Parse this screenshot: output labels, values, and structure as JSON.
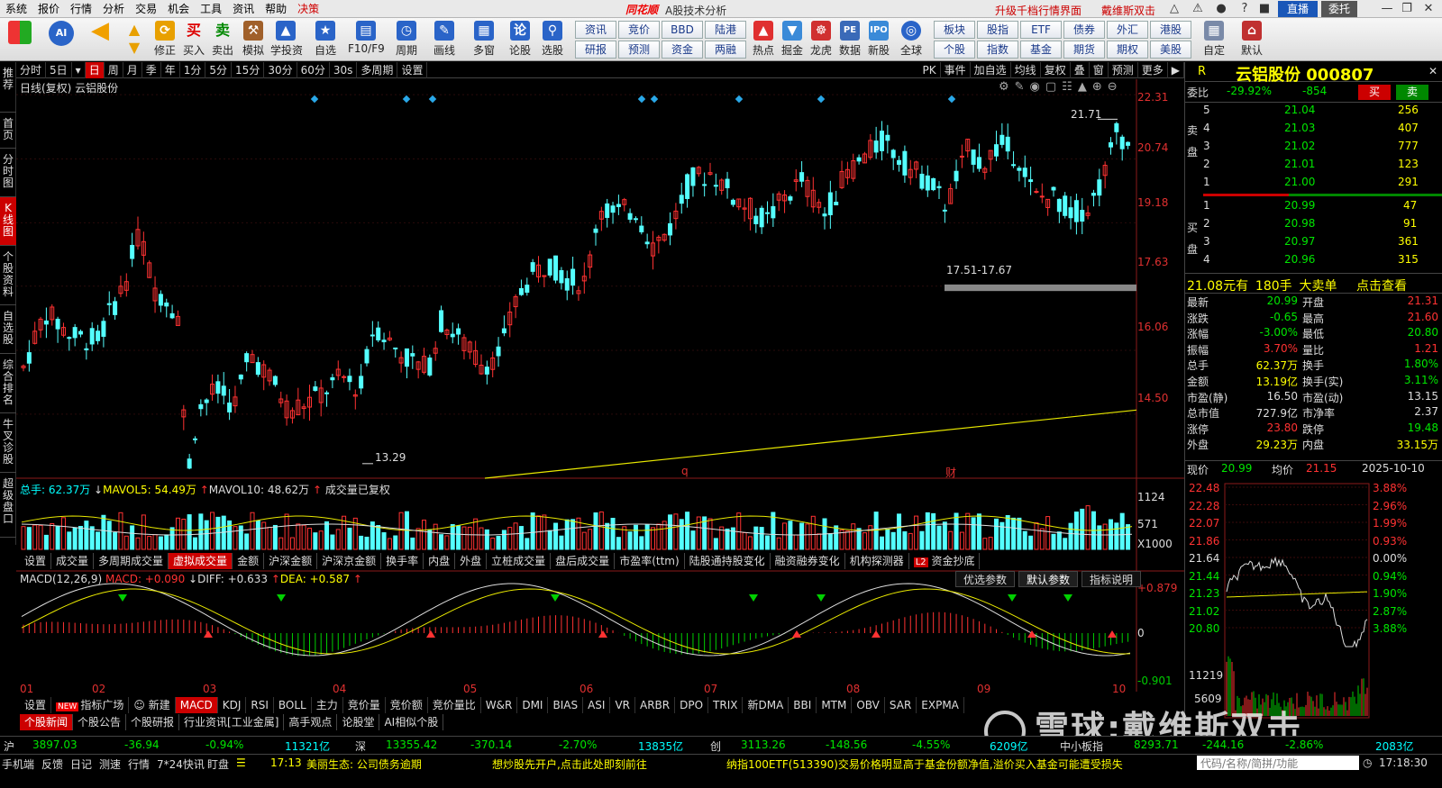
{
  "menu": {
    "items": [
      "系统",
      "报价",
      "行情",
      "分析",
      "交易",
      "机会",
      "工具",
      "资讯",
      "帮助"
    ],
    "highlight": "决策",
    "logo": "同花顺",
    "app_title": "A股技术分析",
    "promo1": "升级千档行情界面",
    "promo2": "戴维斯双击",
    "zhibo": "直播",
    "weituo": "委托"
  },
  "toolbar": {
    "buttons": [
      "修正",
      "买入",
      "卖出",
      "模拟",
      "学投资",
      "自选",
      "F10/F9",
      "周期",
      "画线",
      "多窗",
      "论股",
      "选股"
    ],
    "grid_top": [
      "资讯",
      "竞价",
      "BBD",
      "陆港"
    ],
    "grid_bottom": [
      "研报",
      "预测",
      "资金",
      "两融"
    ],
    "buttons2": [
      "热点",
      "掘金",
      "龙虎",
      "数据",
      "新股",
      "全球"
    ],
    "grid2_top": [
      "板块",
      "股指",
      "ETF",
      "债券",
      "外汇",
      "港股"
    ],
    "grid2_bottom": [
      "个股",
      "指数",
      "基金",
      "期货",
      "期权",
      "美股"
    ],
    "buttons3": [
      "自定",
      "默认"
    ]
  },
  "periods": [
    "分时",
    "5日",
    "日",
    "周",
    "月",
    "季",
    "年",
    "1分",
    "5分",
    "15分",
    "30分",
    "60分",
    "30s",
    "多周期",
    "设置"
  ],
  "active_period": "日",
  "period_right": [
    "PK",
    "事件",
    "加自选",
    "均线",
    "复权",
    "叠",
    "窗",
    "预测",
    "更多"
  ],
  "leftnav": [
    "推荐",
    "首页",
    "分时图",
    "K线图",
    "个股资料",
    "自选股",
    "综合排名",
    "牛叉诊股",
    "超级盘口"
  ],
  "chart": {
    "label": "日线(复权) 云铝股份",
    "price_ticks": [
      "22.31",
      "20.74",
      "19.18",
      "17.63",
      "16.06",
      "14.50"
    ],
    "high_label": "21.71",
    "low_label": "13.29",
    "zone_label": "17.51-17.67",
    "event_q": "q",
    "event_cai": "财",
    "volume_label_total": "总手: 62.37万",
    "volume_label_ma5": "MAVOL5: 54.49万",
    "volume_label_ma10": "MAVOL10: 48.62万",
    "volume_label_note": "成交量已复权",
    "volume_ticks": [
      "1124",
      "571",
      "X1000"
    ],
    "macd_label": "MACD(12,26,9)",
    "macd_value": "MACD: +0.090",
    "diff_value": "DIFF: +0.633",
    "dea_value": "DEA: +0.587",
    "macd_ticks": [
      "+0.879",
      "0",
      "-0.901"
    ],
    "months": [
      "01",
      "02",
      "03",
      "04",
      "05",
      "06",
      "07",
      "08",
      "09",
      "10"
    ]
  },
  "chart_data": {
    "type": "candlestick",
    "title": "日线(复权) 云铝股份",
    "ylim": [
      13.0,
      22.6
    ],
    "y_ticks": [
      22.31,
      20.74,
      19.18,
      17.63,
      16.06,
      14.5
    ],
    "x_months": [
      "01",
      "02",
      "03",
      "04",
      "05",
      "06",
      "07",
      "08",
      "09",
      "10"
    ],
    "key_points": {
      "high": 21.71,
      "low": 13.29,
      "support_zone": [
        17.51,
        17.67
      ]
    },
    "indicators": {
      "MACD": 0.09,
      "DIFF": 0.633,
      "DEA": 0.587,
      "MAVOL5": "54.49万",
      "MAVOL10": "48.62万",
      "volume": "62.37万"
    }
  },
  "tabs_volume": [
    "设置",
    "成交量",
    "多周期成交量",
    "虚拟成交量",
    "金额",
    "沪深金额",
    "沪深京金额",
    "换手率",
    "内盘",
    "外盘",
    "立桩成交量",
    "盘后成交量",
    "市盈率(ttm)",
    "陆股通持股变化",
    "融资融券变化",
    "机构探测器",
    "资金抄底"
  ],
  "tabs_volume_active": "虚拟成交量",
  "macd_buttons": [
    "优选参数",
    "默认参数",
    "指标说明"
  ],
  "tabs_indicators": [
    "设置",
    "指标广场",
    "新建",
    "MACD",
    "KDJ",
    "RSI",
    "BOLL",
    "主力",
    "竞价量",
    "竞价额",
    "竞价量比",
    "W&R",
    "DMI",
    "BIAS",
    "ASI",
    "VR",
    "ARBR",
    "DPO",
    "TRIX",
    "新DMA",
    "BBI",
    "MTM",
    "OBV",
    "SAR",
    "EXPMA"
  ],
  "tabs_indicators_active": "MACD",
  "tabs_news": [
    "个股新闻",
    "个股公告",
    "个股研报",
    "行业资讯[工业金属]",
    "高手观点",
    "论股堂",
    "AI相似个股"
  ],
  "tabs_news_active": "个股新闻",
  "right": {
    "r": "R",
    "name": "云铝股份 000807",
    "weibi_label": "委比",
    "weibi": "-29.92%",
    "weicha": "-854",
    "buy_btn": "买",
    "sell_btn": "卖",
    "sell_side": "卖盘",
    "buy_side": "买盘",
    "asks": [
      {
        "level": "5",
        "price": "21.04",
        "vol": "256"
      },
      {
        "level": "4",
        "price": "21.03",
        "vol": "407"
      },
      {
        "level": "3",
        "price": "21.02",
        "vol": "777"
      },
      {
        "level": "2",
        "price": "21.01",
        "vol": "123"
      },
      {
        "level": "1",
        "price": "21.00",
        "vol": "291"
      }
    ],
    "bids": [
      {
        "level": "1",
        "price": "20.99",
        "vol": "47"
      },
      {
        "level": "2",
        "price": "20.98",
        "vol": "91"
      },
      {
        "level": "3",
        "price": "20.97",
        "vol": "361"
      },
      {
        "level": "4",
        "price": "20.96",
        "vol": "315"
      }
    ],
    "bigorder_price": "21.08",
    "bigorder_unit": "元有",
    "bigorder_vol": "180手",
    "bigorder_type": "大卖单",
    "bigorder_link": "点击查看",
    "stats": [
      {
        "l": "最新",
        "v": "20.99",
        "l2": "开盘",
        "v2": "21.31"
      },
      {
        "l": "涨跌",
        "v": "-0.65",
        "l2": "最高",
        "v2": "21.60"
      },
      {
        "l": "涨幅",
        "v": "-3.00%",
        "l2": "最低",
        "v2": "20.80"
      },
      {
        "l": "振幅",
        "v": "3.70%",
        "l2": "量比",
        "v2": "1.21"
      },
      {
        "l": "总手",
        "v": "62.37万",
        "l2": "换手",
        "v2": "1.80%"
      },
      {
        "l": "金额",
        "v": "13.19亿",
        "l2": "换手(实)",
        "v2": "3.11%"
      },
      {
        "l": "市盈(静)",
        "v": "16.50",
        "l2": "市盈(动)",
        "v2": "13.15"
      },
      {
        "l": "总市值",
        "v": "727.9亿",
        "l2": "市净率",
        "v2": "2.37"
      },
      {
        "l": "涨停",
        "v": "23.80",
        "l2": "跌停",
        "v2": "19.48"
      },
      {
        "l": "外盘",
        "v": "29.23万",
        "l2": "内盘",
        "v2": "33.15万"
      }
    ],
    "mini_label_price": "现价",
    "mini_price": "20.99",
    "mini_label_avg": "均价",
    "mini_avg": "21.15",
    "mini_date": "2025-10-10",
    "mini_left_ticks": [
      "22.48",
      "22.28",
      "22.07",
      "21.86",
      "21.64",
      "21.44",
      "21.23",
      "21.02",
      "20.80"
    ],
    "mini_right_ticks": [
      "3.88%",
      "2.96%",
      "1.99%",
      "0.93%",
      "0.00%",
      "0.94%",
      "1.90%",
      "2.87%",
      "3.88%"
    ],
    "mini_vol_ticks": [
      "11219",
      "5609"
    ]
  },
  "ticker": {
    "sh_label": "沪",
    "sh": "3897.03",
    "sh_chg": "-36.94",
    "sh_pct": "-0.94%",
    "sh_amt": "11321亿",
    "sz_label": "深",
    "sz": "13355.42",
    "sz_chg": "-370.14",
    "sz_pct": "-2.70%",
    "sz_amt": "13835亿",
    "cy_label": "创",
    "cy": "3113.26",
    "cy_chg": "-148.56",
    "cy_pct": "-4.55%",
    "cy_amt": "6209亿",
    "zx_label": "中小板指",
    "zx": "8293.71",
    "zx_chg": "-244.16",
    "zx_pct": "-2.86%",
    "zx_amt": "2083亿"
  },
  "status": {
    "items": [
      "手机端",
      "反馈",
      "日记",
      "测速",
      "行情",
      "7*24快讯",
      "盯盘"
    ],
    "news_time": "17:13",
    "news_text": "美丽生态: 公司债务逾期",
    "ad1": "想炒股先开户,点击此处即刻前往",
    "ad2": "纳指100ETF(513390)交易价格明显高于基金份额净值,溢价买入基金可能遭受损失",
    "search_placeholder": "代码/名称/简拼/功能",
    "clock": "17:18:30"
  },
  "watermark": "雪球:戴维斯双击"
}
